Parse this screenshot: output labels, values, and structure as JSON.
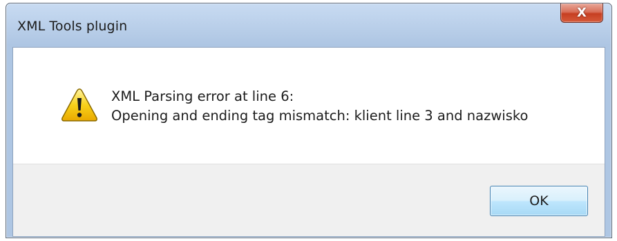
{
  "window": {
    "title": "XML Tools plugin",
    "close_glyph": "X"
  },
  "message": {
    "icon": "warning-icon",
    "line1": "XML Parsing error at line 6:",
    "line2": "Opening and ending tag mismatch: klient line 3 and nazwisko"
  },
  "buttons": {
    "ok_label": "OK"
  },
  "colors": {
    "warning_yellow": "#f5c400",
    "close_red": "#c63f22",
    "button_border": "#3c7fb1"
  }
}
